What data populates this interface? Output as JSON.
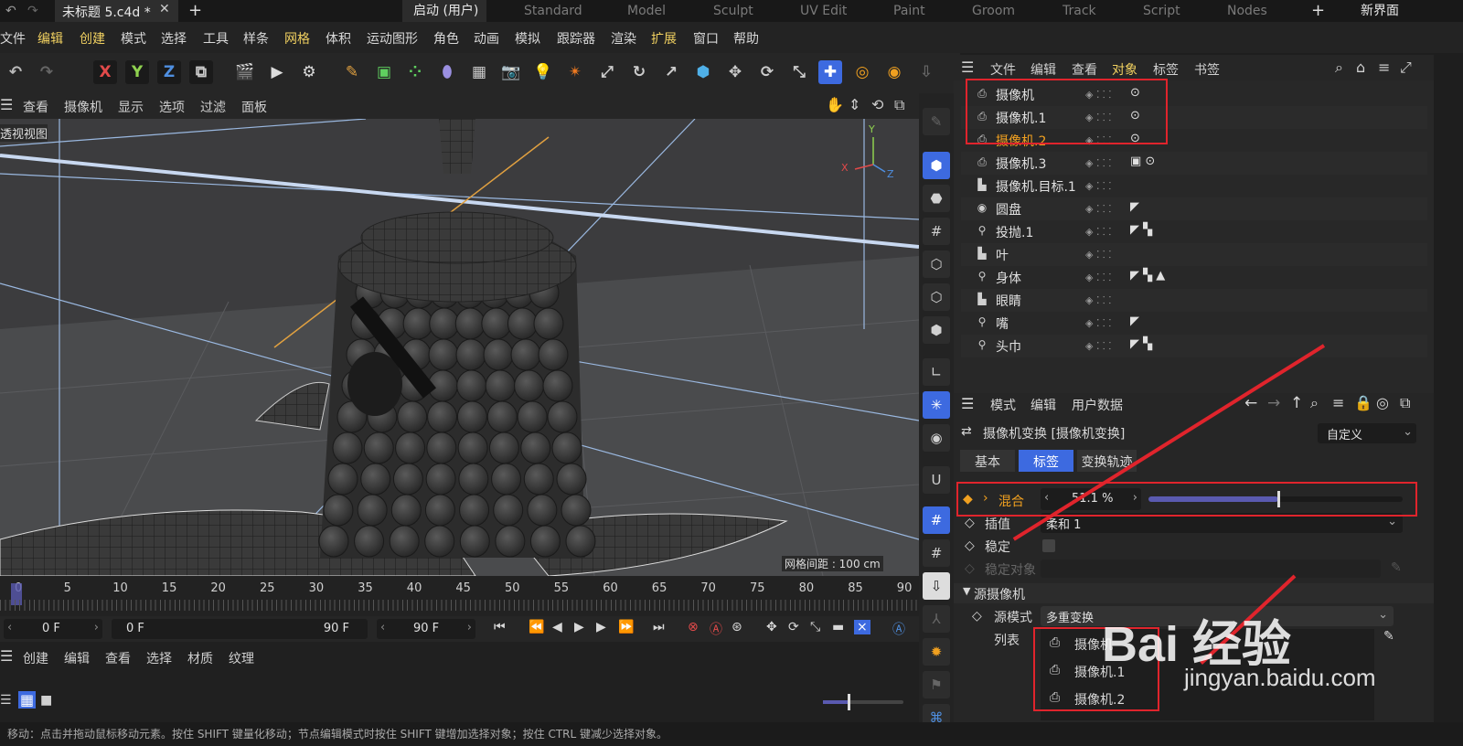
{
  "topbar": {
    "doc_tab": "未标题 5.c4d *",
    "layouts": [
      "启动 (用户)",
      "Standard",
      "Model",
      "Sculpt",
      "UV Edit",
      "Paint",
      "Groom",
      "Track",
      "Script",
      "Nodes"
    ],
    "new_layout": "新界面"
  },
  "menu": [
    "文件",
    "编辑",
    "创建",
    "模式",
    "选择",
    "工具",
    "样条",
    "网格",
    "体积",
    "运动图形",
    "角色",
    "动画",
    "模拟",
    "跟踪器",
    "渲染",
    "扩展",
    "窗口",
    "帮助"
  ],
  "toolbar": {
    "x": "X",
    "y": "Y",
    "z": "Z"
  },
  "viewport": {
    "menu": [
      "查看",
      "摄像机",
      "显示",
      "选项",
      "过滤",
      "面板"
    ],
    "view_label": "透视视图",
    "grid_info": "网格间距 : 100 cm",
    "axis_x": "X",
    "axis_y": "Y",
    "axis_z": "Z"
  },
  "objects": {
    "menu": [
      "文件",
      "编辑",
      "查看",
      "对象",
      "标签",
      "书签"
    ],
    "rows": [
      {
        "name": "摄像机",
        "icon": "camera-icon",
        "tags": "⊙"
      },
      {
        "name": "摄像机.1",
        "icon": "camera-icon",
        "tags": "⊙"
      },
      {
        "name": "摄像机.2",
        "icon": "camera-icon",
        "tags": "⊙"
      },
      {
        "name": "摄像机.3",
        "icon": "camera-icon",
        "tags": "▣ ⊙"
      },
      {
        "name": "摄像机.目标.1",
        "icon": "null-icon",
        "tags": ""
      },
      {
        "name": "圆盘",
        "icon": "disc-icon",
        "tags": "◤"
      },
      {
        "name": "投抛.1",
        "icon": "person-icon",
        "tags": "◤ ▚"
      },
      {
        "name": "叶",
        "icon": "null-icon",
        "tags": ""
      },
      {
        "name": "身体",
        "icon": "person-icon",
        "tags": "◤ ▚ ▲"
      },
      {
        "name": "眼睛",
        "icon": "null-icon",
        "tags": ""
      },
      {
        "name": "嘴",
        "icon": "person-icon",
        "tags": "◤"
      },
      {
        "name": "头巾",
        "icon": "person-icon",
        "tags": "◤ ▚"
      }
    ]
  },
  "attributes": {
    "menu": [
      "模式",
      "编辑",
      "用户数据"
    ],
    "title": "摄像机变换 [摄像机变换]",
    "preset": "自定义",
    "tabs": [
      "基本",
      "标签",
      "变换轨迹"
    ],
    "blend_label": "混合",
    "blend_value": "51.1 %",
    "blend_fraction": 0.511,
    "interp_label": "插值",
    "interp_value": "柔和 1",
    "stabilize_label": "稳定",
    "stabilize_target_label": "稳定对象",
    "section_source": "源摄像机",
    "source_mode_label": "源模式",
    "source_mode_value": "多重变换",
    "list_label": "列表",
    "list_items": [
      "摄像机",
      "摄像机.1",
      "摄像机.2"
    ]
  },
  "timeline": {
    "ticks": [
      "0",
      "5",
      "10",
      "15",
      "20",
      "25",
      "30",
      "35",
      "40",
      "45",
      "50",
      "55",
      "60",
      "65",
      "70",
      "75",
      "80",
      "85",
      "90"
    ],
    "current": "0 F",
    "start": "0 F",
    "end": "90 F",
    "end2": "90 F"
  },
  "material_menu": [
    "创建",
    "编辑",
    "查看",
    "选择",
    "材质",
    "纹理"
  ],
  "status": "移动：点击并拖动鼠标移动元素。按住 SHIFT 键量化移动；节点编辑模式时按住 SHIFT 键增加选择对象；按住 CTRL 键减少选择对象。",
  "watermark": {
    "brand": "Bai 经验",
    "url": "jingyan.baidu.com"
  },
  "colors": {
    "accent": "#3d6ae0",
    "highlight": "#f0a020",
    "annotation": "#e0242c"
  }
}
